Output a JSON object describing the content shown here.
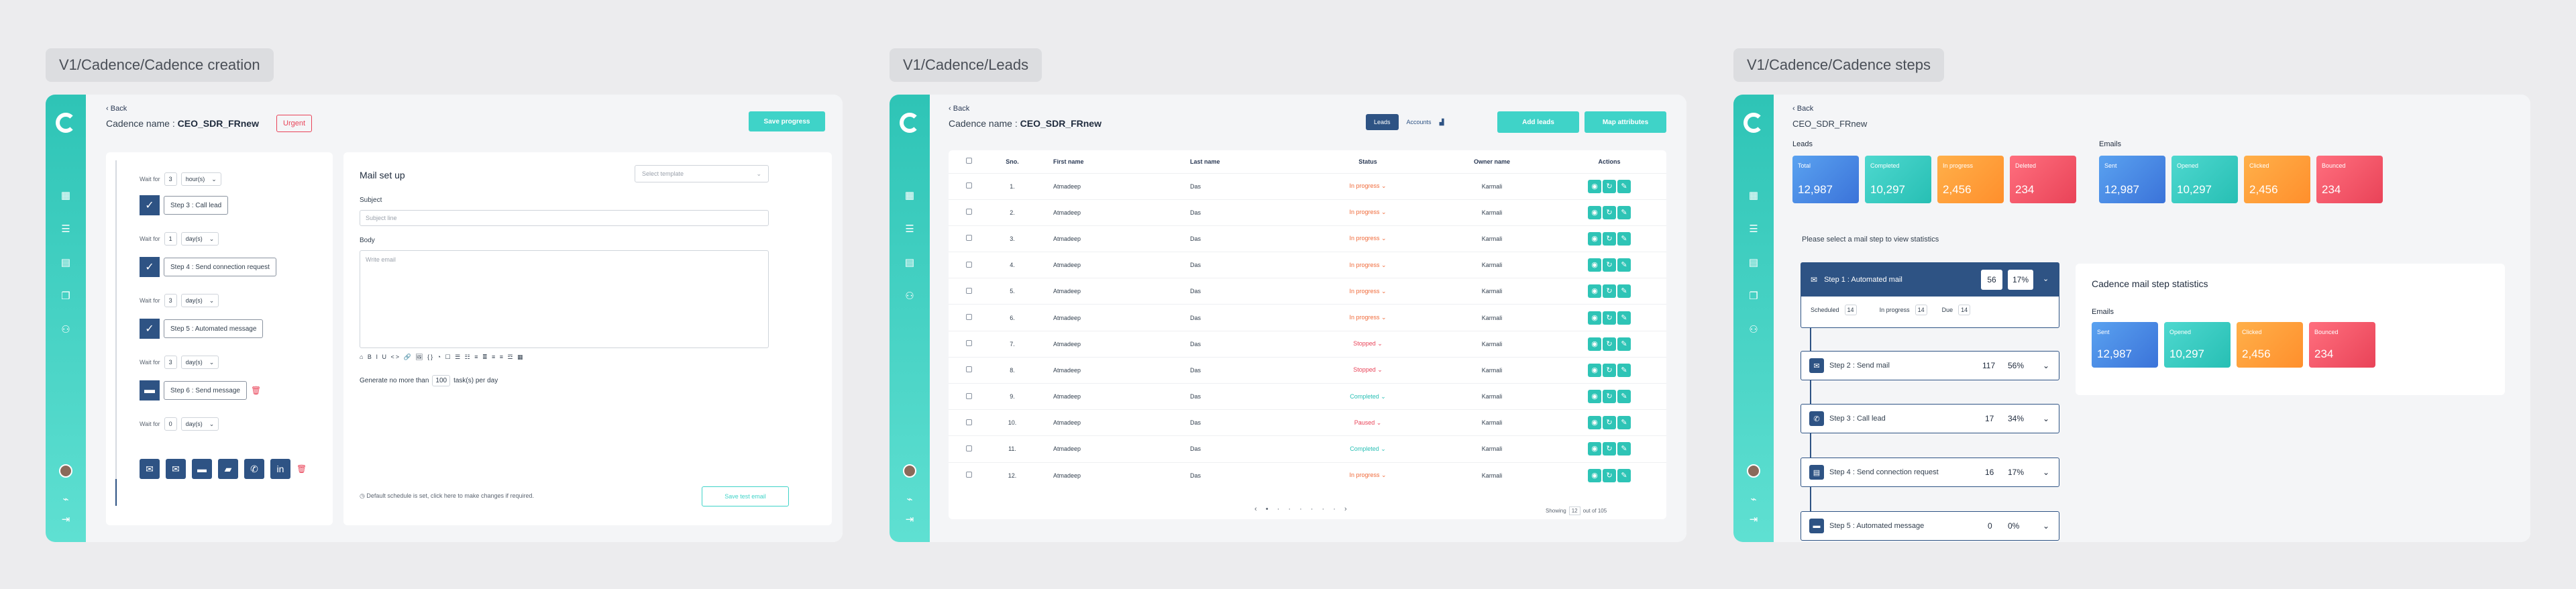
{
  "labels": {
    "creation": "V1/Cadence/Cadence creation",
    "leads": "V1/Cadence/Leads",
    "steps": "V1/Cadence/Cadence steps"
  },
  "creation": {
    "back": "Back",
    "cadence_prefix": "Cadence name : ",
    "cadence_name": "CEO_SDR_FRnew",
    "urgent": "Urgent",
    "save": "Save progress",
    "wait_label": "Wait for",
    "waits": [
      {
        "n": "3",
        "unit": "hour(s)"
      },
      {
        "n": "1",
        "unit": "day(s)"
      },
      {
        "n": "3",
        "unit": "day(s)"
      },
      {
        "n": "3",
        "unit": "day(s)"
      },
      {
        "n": "0",
        "unit": "day(s)"
      }
    ],
    "steps": [
      "Step 3 : Call lead",
      "Step 4 : Send connection request",
      "Step 5 : Automated message",
      "Step 6 : Send message"
    ],
    "mail_title": "Mail set up",
    "template_ph": "Select template",
    "subject_label": "Subject",
    "subject_ph": "Subject line",
    "body_label": "Body",
    "body_ph": "Write email",
    "toolbar": "⌂ B I U <> 🔗 🖼 {} ◔ ☐ ☰ ☷ ≡ ≣ ≡ ≡ ☲ ▦",
    "gen_prefix": "Generate no more than",
    "gen_val": "100",
    "gen_suffix": "task(s) per day",
    "schedule_note": "Default schedule is set, click here to make changes if required.",
    "save_mail": "Save test email"
  },
  "leads": {
    "back": "Back",
    "cadence_prefix": "Cadence name : ",
    "cadence_name": "CEO_SDR_FRnew",
    "tab_leads": "Leads",
    "tab_accounts": "Accounts",
    "add": "Add leads",
    "map": "Map attributes",
    "cols": [
      "Sno.",
      "First name",
      "Last name",
      "Status",
      "Owner name",
      "Actions"
    ],
    "rows": [
      {
        "sno": "1.",
        "fn": "Atmadeep",
        "ln": "Das",
        "status": "In progress",
        "owner": "Karmali"
      },
      {
        "sno": "2.",
        "fn": "Atmadeep",
        "ln": "Das",
        "status": "In progress",
        "owner": "Karmali"
      },
      {
        "sno": "3.",
        "fn": "Atmadeep",
        "ln": "Das",
        "status": "In progress",
        "owner": "Karmali"
      },
      {
        "sno": "4.",
        "fn": "Atmadeep",
        "ln": "Das",
        "status": "In progress",
        "owner": "Karmali"
      },
      {
        "sno": "5.",
        "fn": "Atmadeep",
        "ln": "Das",
        "status": "In progress",
        "owner": "Karmali"
      },
      {
        "sno": "6.",
        "fn": "Atmadeep",
        "ln": "Das",
        "status": "In progress",
        "owner": "Karmali"
      },
      {
        "sno": "7.",
        "fn": "Atmadeep",
        "ln": "Das",
        "status": "Stopped",
        "owner": "Karmali"
      },
      {
        "sno": "8.",
        "fn": "Atmadeep",
        "ln": "Das",
        "status": "Stopped",
        "owner": "Karmali"
      },
      {
        "sno": "9.",
        "fn": "Atmadeep",
        "ln": "Das",
        "status": "Completed",
        "owner": "Karmali"
      },
      {
        "sno": "10.",
        "fn": "Atmadeep",
        "ln": "Das",
        "status": "Paused",
        "owner": "Karmali"
      },
      {
        "sno": "11.",
        "fn": "Atmadeep",
        "ln": "Das",
        "status": "Completed",
        "owner": "Karmali"
      },
      {
        "sno": "12.",
        "fn": "Atmadeep",
        "ln": "Das",
        "status": "In progress",
        "owner": "Karmali"
      }
    ],
    "showing": "Showing",
    "per_page": "12",
    "out_of": "out of 105",
    "status_colors": {
      "In progress": "#f06a3a",
      "Stopped": "#e94358",
      "Completed": "#27bfb4",
      "Paused": "#e94358"
    }
  },
  "steps": {
    "back": "Back",
    "cadence_name": "CEO_SDR_FRnew",
    "leads_title": "Leads",
    "emails_title": "Emails",
    "lead_cards": [
      {
        "l": "Total",
        "v": "12,987"
      },
      {
        "l": "Completed",
        "v": "10,297"
      },
      {
        "l": "In progress",
        "v": "2,456"
      },
      {
        "l": "Deleted",
        "v": "234"
      }
    ],
    "email_cards": [
      {
        "l": "Sent",
        "v": "12,987"
      },
      {
        "l": "Opened",
        "v": "10,297"
      },
      {
        "l": "Clicked",
        "v": "2,456"
      },
      {
        "l": "Bounced",
        "v": "234"
      }
    ],
    "prompt": "Please select a mail step to view statistics",
    "step1": {
      "label": "Step 1 : Automated mail",
      "count": "56",
      "pct": "17%",
      "scheduled": "Scheduled",
      "in_progress": "In progress",
      "due": "Due",
      "s_n": "14",
      "p_n": "14",
      "d_n": "14"
    },
    "others": [
      {
        "label": "Step 2 : Send mail",
        "count": "117",
        "pct": "56%"
      },
      {
        "label": "Step 3 : Call lead",
        "count": "17",
        "pct": "34%"
      },
      {
        "label": "Step 4 : Send connection request",
        "count": "16",
        "pct": "17%"
      },
      {
        "label": "Step 5 : Automated message",
        "count": "0",
        "pct": "0%"
      }
    ],
    "stats_title": "Cadence mail step statistics",
    "stats_emails": "Emails",
    "stat_cards": [
      {
        "l": "Sent",
        "v": "12,987"
      },
      {
        "l": "Opened",
        "v": "10,297"
      },
      {
        "l": "Clicked",
        "v": "2,456"
      },
      {
        "l": "Bounced",
        "v": "234"
      }
    ]
  }
}
